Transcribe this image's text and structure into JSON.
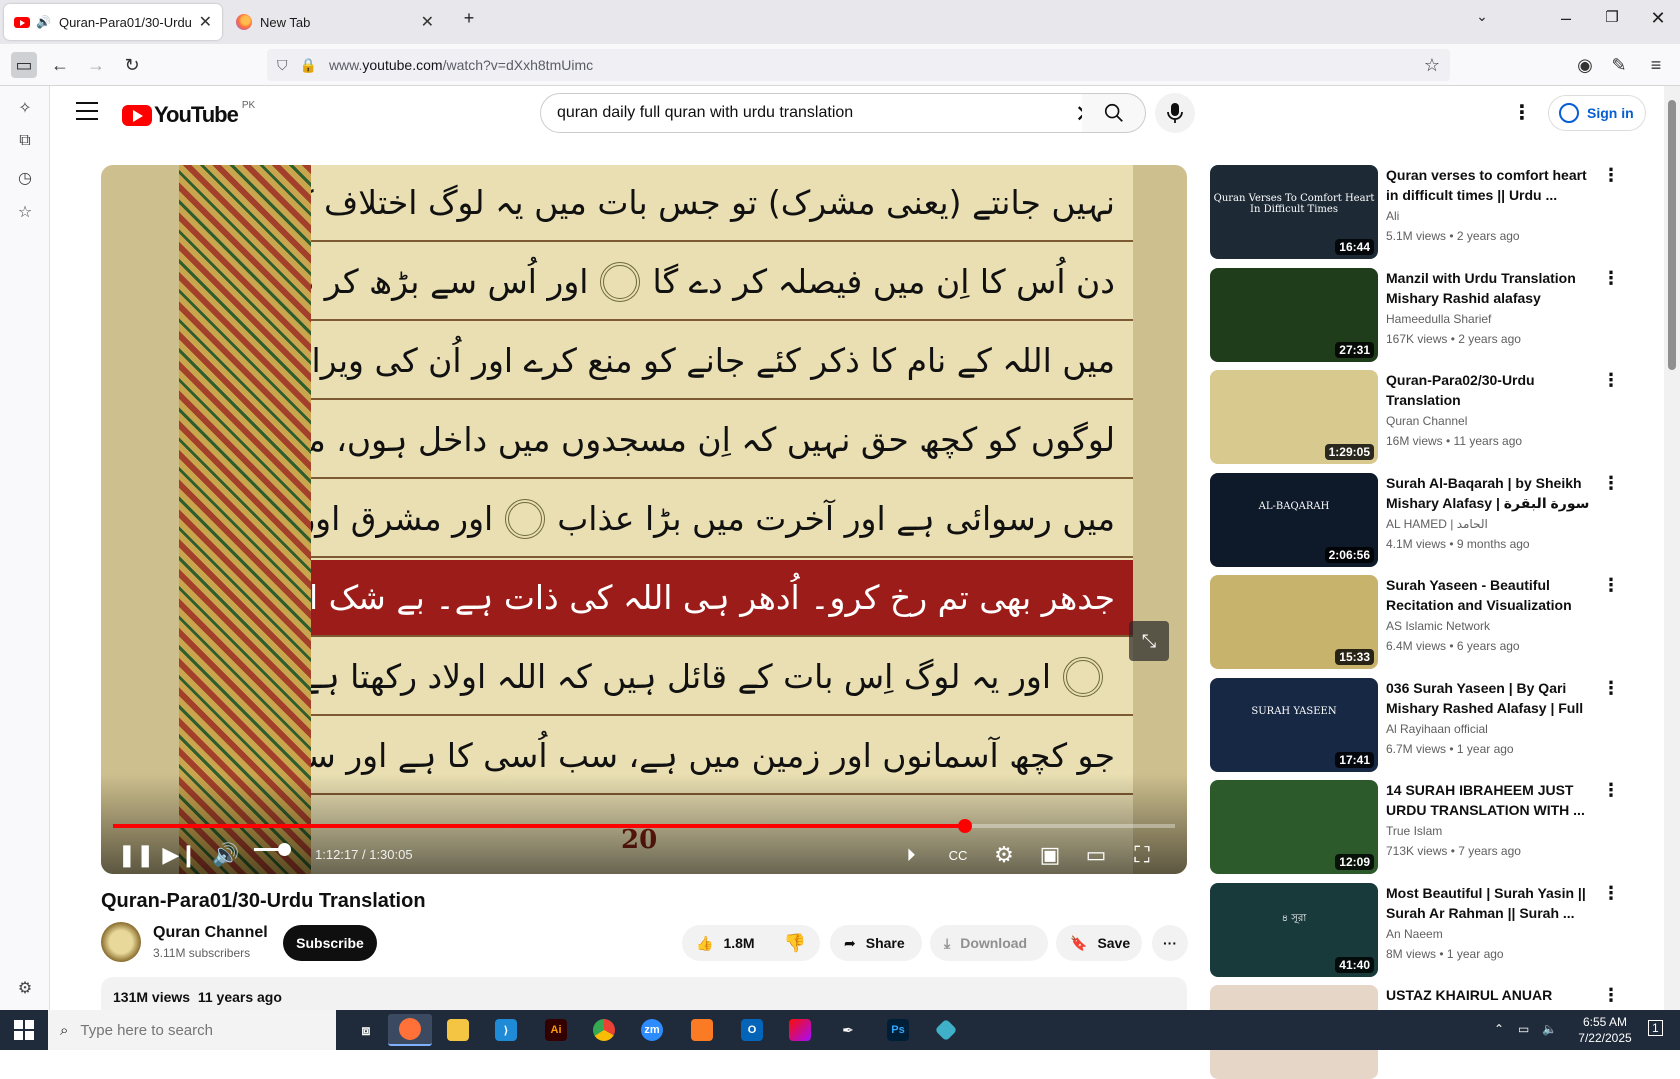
{
  "browser": {
    "tabs": [
      {
        "title": "Quran-Para01/30-Urdu Translation - YouTube",
        "active": true,
        "audio": true
      },
      {
        "title": "New Tab",
        "active": false
      }
    ],
    "url_prefix": "www.",
    "url_domain": "youtube.com",
    "url_path": "/watch?v=dXxh8tmUimc"
  },
  "youtube": {
    "logo_text": "YouTube",
    "country_code": "PK",
    "search_value": "quran daily full quran with urdu translation",
    "search_placeholder": "Search",
    "sign_in_label": "Sign in"
  },
  "player": {
    "lines": [
      "نہیں جانتے (یعنی مشرک) تو جس بات میں یہ لوگ اختلاف کر رہے ہیں اللہ قیامت کے",
      "دن اُس کا اِن میں فیصلہ کر دے گا",
      "اور اُس سے بڑھ کر ظالم کون، جو اللہ کی مسجدوں",
      "میں اللہ کے نام کا ذکر کئے جانے کو منع کرے اور اُن کی ویرانی کیلئے کوشش کرے۔ اِن",
      "لوگوں کو کچھ حق نہیں کہ اِن مسجدوں میں داخل ہوں، مگر ڈرتے ہوئے۔ اِن کے لیے دنیا",
      "میں رسوائی ہے اور آخرت میں بڑا عذاب",
      "اور مشرق اور مغرب سب اللہ ہی کا ہے۔ تو",
      "جدھر بھی تم رخ کرو۔ اُدھر ہی اللہ کی ذات ہے۔ بے شک اللہ صاحبِ وسعت ہے باخبر ہے",
      "اور یہ لوگ اِس بات کے قائل ہیں کہ اللہ اولاد رکھتا ہے۔ (نہیں) وہ پاک ہے، بلکہ",
      "جو کچھ آسمانوں اور زمین میں ہے، سب اُسی کا ہے اور سب اُس کے فرماں بردار ہیں"
    ],
    "page_number": "20",
    "current_time": "1:12:17",
    "duration": "1:30:05",
    "time_display": "1:12:17 / 1:30:05",
    "progress_fraction": 0.802,
    "volume_fraction": 0.75
  },
  "video": {
    "title": "Quran-Para01/30-Urdu Translation",
    "channel": "Quran Channel",
    "subscribers": "3.11M subscribers",
    "subscribe_label": "Subscribe",
    "likes": "1.8M",
    "share_label": "Share",
    "download_label": "Download",
    "save_label": "Save",
    "views": "131M views",
    "age": "11 years ago"
  },
  "recommendations": [
    {
      "title": "Quran verses to comfort heart in difficult times || Urdu ...",
      "channel": "Ali",
      "meta": "5.1M views • 2 years ago",
      "duration": "16:44",
      "thumb_text": "Quran Verses To Comfort Heart In Difficult Times",
      "thumb_color": "#1d2a36"
    },
    {
      "title": "Manzil with Urdu Translation Mishary Rashid alafasy",
      "channel": "Hameedulla Sharief",
      "meta": "167K views • 2 years ago",
      "duration": "27:31",
      "thumb_text": "",
      "thumb_color": "#1f3d1a"
    },
    {
      "title": "Quran-Para02/30-Urdu Translation",
      "channel": "Quran Channel",
      "meta": "16M views • 11 years ago",
      "duration": "1:29:05",
      "thumb_text": "",
      "thumb_color": "#d8c98f"
    },
    {
      "title": "Surah Al-Baqarah | by Sheikh Mishary Alafasy | سورة البقرة بصوت",
      "channel": "AL HAMED | الحامد",
      "meta": "4.1M views • 9 months ago",
      "duration": "2:06:56",
      "thumb_text": "AL-BAQARAH",
      "thumb_color": "#0e1a2a"
    },
    {
      "title": "Surah Yaseen - Beautiful Recitation and Visualization of...",
      "channel": "AS Islamic Network",
      "meta": "6.4M views • 6 years ago",
      "duration": "15:33",
      "thumb_text": "",
      "thumb_color": "#c8b36c"
    },
    {
      "title": "036 Surah Yaseen | By Qari Mishary Rashed Alafasy | Full |...",
      "channel": "Al Rayihaan official",
      "meta": "6.7M views • 1 year ago",
      "duration": "17:41",
      "thumb_text": "SURAH YASEEN",
      "thumb_color": "#172844"
    },
    {
      "title": "14 SURAH IBRAHEEM JUST URDU TRANSLATION WITH ...",
      "channel": "True Islam",
      "meta": "713K views • 7 years ago",
      "duration": "12:09",
      "thumb_text": "",
      "thumb_color": "#2c5a2a"
    },
    {
      "title": "Most Beautiful | Surah Yasin || Surah Ar Rahman || Surah ...",
      "channel": "An Naeem",
      "meta": "8M views • 1 year ago",
      "duration": "41:40",
      "thumb_text": "৪ সূরা",
      "thumb_color": "#183a3a"
    },
    {
      "title": "USTAZ KHAIRUL ANUAR BASRI",
      "channel": "",
      "meta": "",
      "duration": "",
      "thumb_text": "",
      "thumb_color": "#e6d6c8"
    }
  ],
  "taskbar": {
    "search_placeholder": "Type here to search",
    "time": "6:55 AM",
    "date": "7/22/2025",
    "notifications": "1"
  }
}
